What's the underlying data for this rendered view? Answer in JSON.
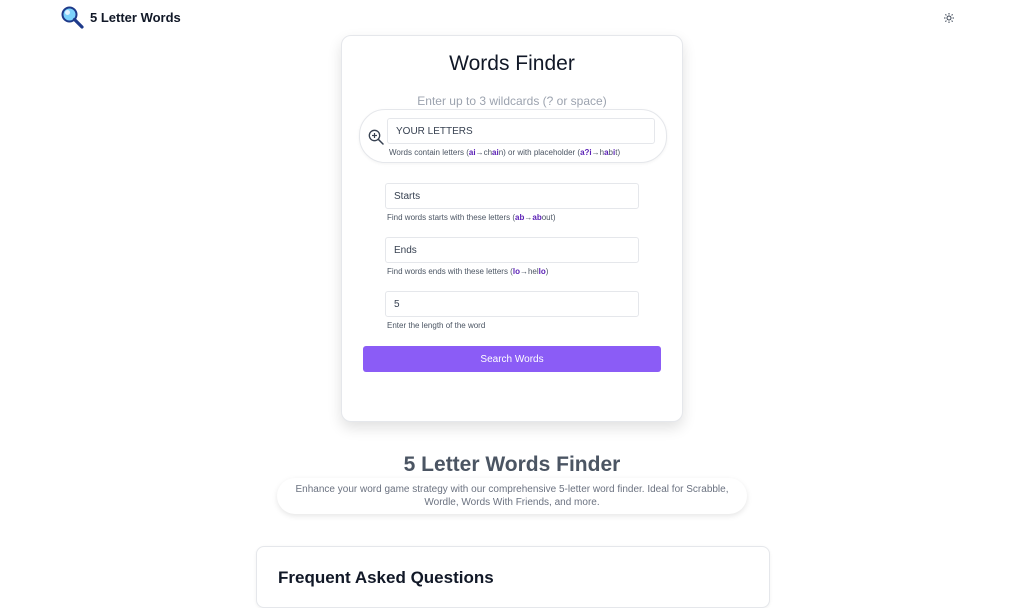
{
  "header": {
    "logo_icon": "magnifier-icon",
    "logo_text": "5 Letter Words",
    "theme_icon": "sun-icon"
  },
  "finder": {
    "title": "Words Finder",
    "wildcard_hint": "Enter up to 3 wildcards (? or space)",
    "letters_placeholder": "YOUR LETTERS",
    "letters_help": {
      "prefix": "Words contain letters (",
      "ex1_a": "ai",
      "ex1_arrow": "→",
      "ex1_b": "ch",
      "ex1_c": "ai",
      "ex1_d": "n",
      "middle": ") or with placeholder (",
      "ex2_a": "a?i",
      "ex2_arrow": "→",
      "ex2_b": "h",
      "ex2_c": "a",
      "ex2_d": "b",
      "ex2_e": "i",
      "ex2_f": "t",
      "suffix": ")"
    },
    "starts_placeholder": "Starts",
    "starts_help": {
      "prefix": "Find words starts with these letters (",
      "a": "ab",
      "arrow": "→",
      "b": "ab",
      "c": "out",
      "suffix": ")"
    },
    "ends_placeholder": "Ends",
    "ends_help": {
      "prefix": "Find words ends with these letters (",
      "a": "lo",
      "arrow": "→",
      "b": "hel",
      "c": "lo",
      "suffix": ")"
    },
    "length_value": "5",
    "length_help": "Enter the length of the word",
    "search_label": "Search Words",
    "accent_color": "#8b5cf6"
  },
  "hero": {
    "title": "5 Letter Words Finder",
    "description": "Enhance your word game strategy with our comprehensive 5-letter word finder. Ideal for Scrabble, Wordle, Words With Friends, and more."
  },
  "faq": {
    "title": "Frequent Asked Questions"
  }
}
